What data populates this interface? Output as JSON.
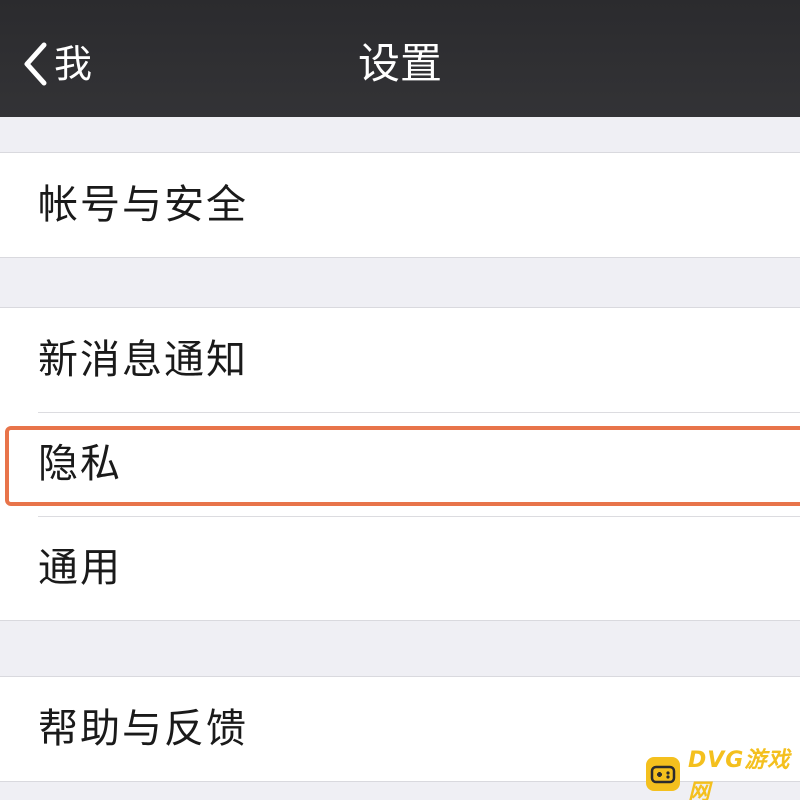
{
  "nav": {
    "back_label": "我",
    "title": "设置"
  },
  "sections": [
    {
      "items": [
        {
          "label": "帐号与安全"
        }
      ]
    },
    {
      "items": [
        {
          "label": "新消息通知"
        },
        {
          "label": "隐私"
        },
        {
          "label": "通用"
        }
      ]
    },
    {
      "items": [
        {
          "label": "帮助与反馈"
        }
      ]
    }
  ],
  "highlight": {
    "target": "隐私",
    "color": "#e8744a"
  },
  "watermark": {
    "text": "DVG游戏网",
    "color": "#f4c01e"
  },
  "colors": {
    "nav_background": "#2e2e31",
    "page_background": "#efeff4",
    "cell_background": "#ffffff"
  },
  "icons": {
    "back": "chevron-left-icon",
    "watermark_logo": "gamepad-icon"
  }
}
